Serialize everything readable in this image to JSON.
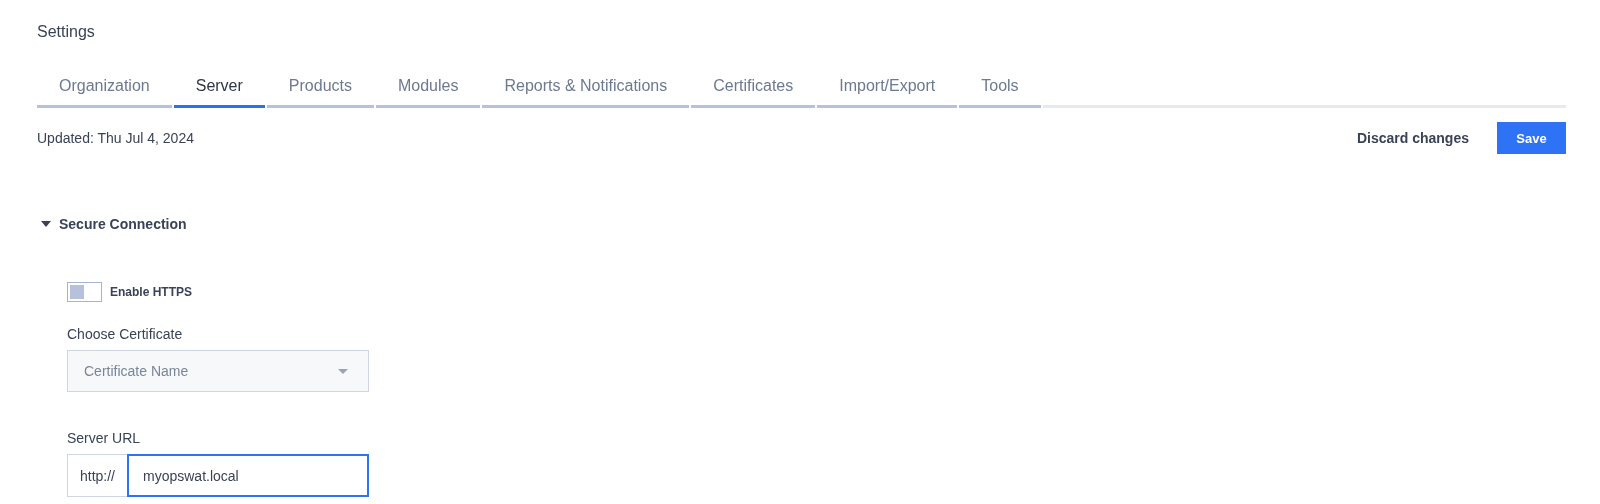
{
  "page": {
    "title": "Settings"
  },
  "tabs": [
    {
      "label": "Organization",
      "selected": false
    },
    {
      "label": "Server",
      "selected": true
    },
    {
      "label": "Products",
      "selected": false
    },
    {
      "label": "Modules",
      "selected": false
    },
    {
      "label": "Reports & Notifications",
      "selected": false
    },
    {
      "label": "Certificates",
      "selected": false
    },
    {
      "label": "Import/Export",
      "selected": false
    },
    {
      "label": "Tools",
      "selected": false
    }
  ],
  "updated": "Updated: Thu Jul 4, 2024",
  "actions": {
    "discard": "Discard changes",
    "save": "Save"
  },
  "section": {
    "title": "Secure Connection",
    "expanded": true,
    "https_toggle": {
      "label": "Enable HTTPS",
      "on": false
    },
    "certificate": {
      "label": "Choose Certificate",
      "placeholder": "Certificate Name",
      "disabled": true
    },
    "server_url": {
      "label": "Server URL",
      "prefix": "http://",
      "value": "myopswat.local"
    }
  }
}
